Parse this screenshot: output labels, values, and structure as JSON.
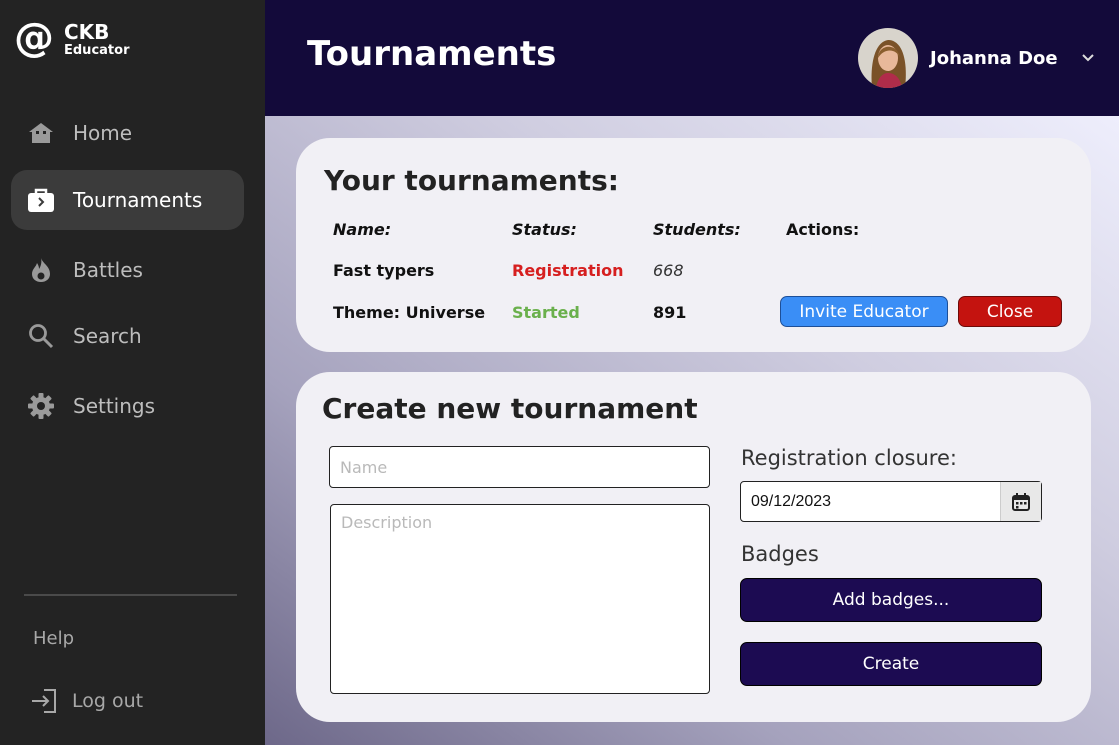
{
  "brand": {
    "title": "CKB",
    "subtitle": "Educator"
  },
  "sidebar": {
    "items": [
      {
        "label": "Home",
        "icon": "home-icon"
      },
      {
        "label": "Tournaments",
        "icon": "briefcase-icon",
        "active": true
      },
      {
        "label": "Battles",
        "icon": "flame-icon"
      },
      {
        "label": "Search",
        "icon": "search-icon"
      },
      {
        "label": "Settings",
        "icon": "gear-icon"
      }
    ],
    "help": "Help",
    "logout": "Log out"
  },
  "header": {
    "title": "Tournaments",
    "user_name": "Johanna Doe"
  },
  "your_tournaments": {
    "title": "Your tournaments:",
    "columns": [
      "Name:",
      "Status:",
      "Students:",
      "Actions:"
    ],
    "rows": [
      {
        "name": "Fast typers",
        "status": "Registration",
        "students": "668"
      },
      {
        "name": "Theme: Universe",
        "status": "Started",
        "students": "891",
        "actions": [
          "Invite Educator",
          "Close"
        ]
      }
    ]
  },
  "create": {
    "title": "Create new tournament",
    "name_placeholder": "Name",
    "description_placeholder": "Description",
    "registration_label": "Registration closure:",
    "registration_value": "09/12/2023",
    "badges_label": "Badges",
    "add_badges": "Add badges...",
    "create_button": "Create"
  },
  "colors": {
    "accent": "#130a3a",
    "status_registration": "#d61f1f",
    "status_started": "#6ab04c",
    "invite": "#3a8ef6",
    "close": "#c4130f"
  }
}
